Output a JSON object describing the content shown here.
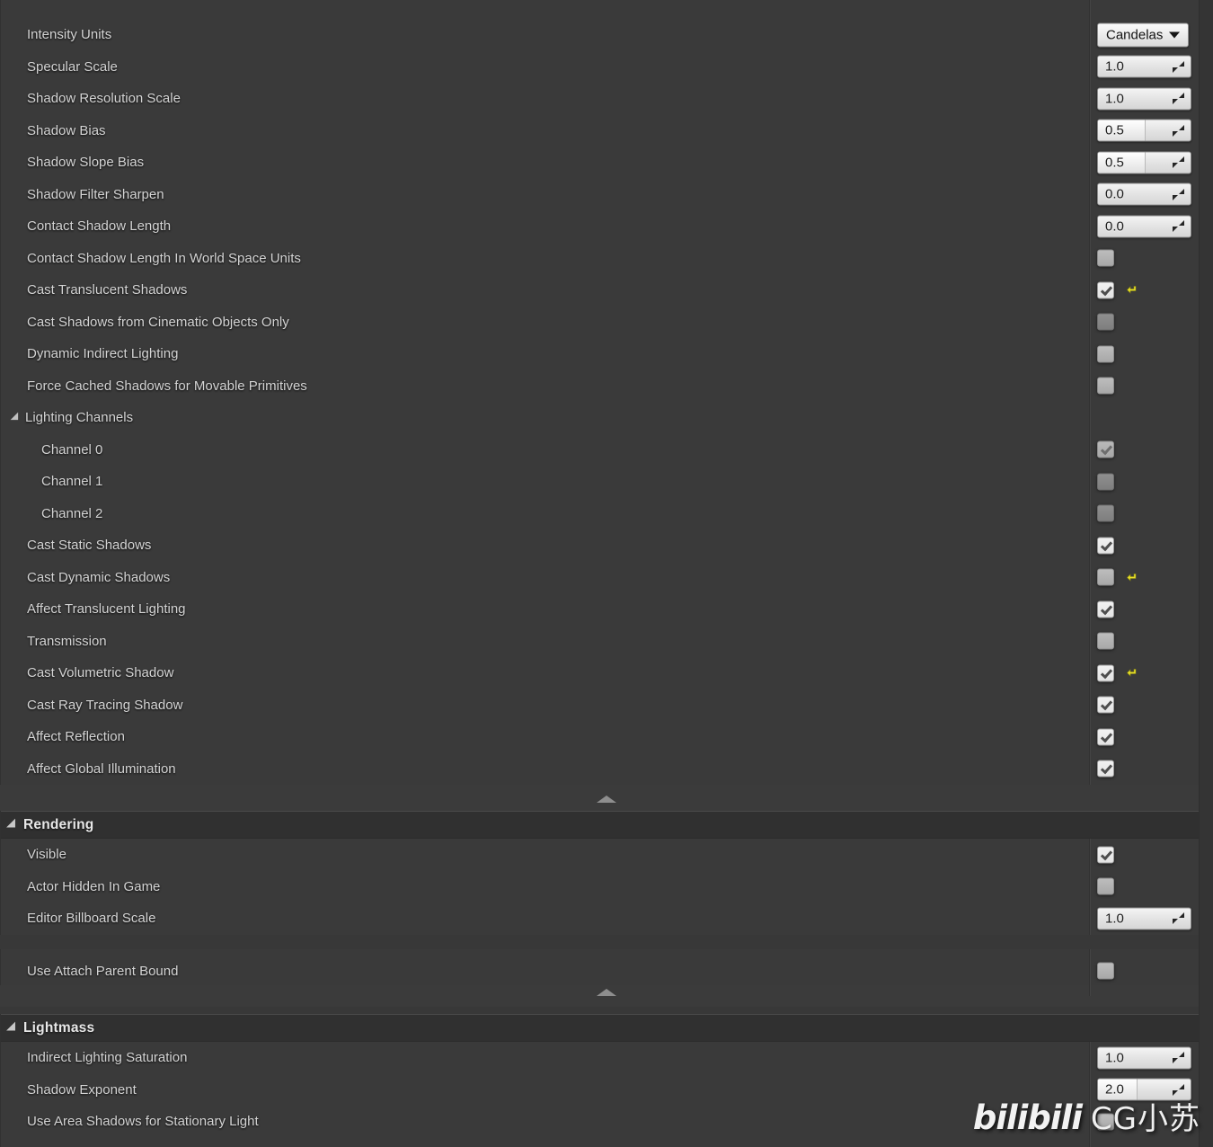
{
  "panel": {
    "light_section": {
      "rows": [
        {
          "label": "Intensity Units",
          "control": "combo",
          "value": "Candelas",
          "indent": 0
        },
        {
          "label": "Specular Scale",
          "control": "spin",
          "value": "1.0",
          "fill": 0,
          "indent": 0
        },
        {
          "label": "Shadow Resolution Scale",
          "control": "spin",
          "value": "1.0",
          "fill": 0,
          "indent": 0
        },
        {
          "label": "Shadow Bias",
          "control": "spin",
          "value": "0.5",
          "fill": 50,
          "indent": 0
        },
        {
          "label": "Shadow Slope Bias",
          "control": "spin",
          "value": "0.5",
          "fill": 50,
          "indent": 0
        },
        {
          "label": "Shadow Filter Sharpen",
          "control": "spin",
          "value": "0.0",
          "fill": 0,
          "indent": 0
        },
        {
          "label": "Contact Shadow Length",
          "control": "spin",
          "value": "0.0",
          "fill": 0,
          "indent": 0
        },
        {
          "label": "Contact Shadow Length In World Space Units",
          "control": "checkbox",
          "checked": false,
          "dim": false,
          "revert": false,
          "indent": 0
        },
        {
          "label": "Cast Translucent Shadows",
          "control": "checkbox",
          "checked": true,
          "dim": false,
          "revert": true,
          "indent": 0
        },
        {
          "label": "Cast Shadows from Cinematic Objects Only",
          "control": "checkbox",
          "checked": false,
          "dim": true,
          "revert": false,
          "indent": 0
        },
        {
          "label": "Dynamic Indirect Lighting",
          "control": "checkbox",
          "checked": false,
          "dim": false,
          "revert": false,
          "indent": 0
        },
        {
          "label": "Force Cached Shadows for Movable Primitives",
          "control": "checkbox",
          "checked": false,
          "dim": false,
          "revert": false,
          "indent": 0
        },
        {
          "label": "Lighting Channels",
          "control": "group",
          "expanded": true,
          "indent": 0
        },
        {
          "label": "Channel 0",
          "control": "checkbox",
          "checked": true,
          "dim": true,
          "revert": false,
          "indent": 1
        },
        {
          "label": "Channel 1",
          "control": "checkbox",
          "checked": false,
          "dim": true,
          "revert": false,
          "indent": 1
        },
        {
          "label": "Channel 2",
          "control": "checkbox",
          "checked": false,
          "dim": true,
          "revert": false,
          "indent": 1
        },
        {
          "label": "Cast Static Shadows",
          "control": "checkbox",
          "checked": true,
          "dim": false,
          "revert": false,
          "indent": 0
        },
        {
          "label": "Cast Dynamic Shadows",
          "control": "checkbox",
          "checked": false,
          "dim": false,
          "revert": true,
          "indent": 0
        },
        {
          "label": "Affect Translucent Lighting",
          "control": "checkbox",
          "checked": true,
          "dim": false,
          "revert": false,
          "indent": 0
        },
        {
          "label": "Transmission",
          "control": "checkbox",
          "checked": false,
          "dim": false,
          "revert": false,
          "indent": 0
        },
        {
          "label": "Cast Volumetric Shadow",
          "control": "checkbox",
          "checked": true,
          "dim": false,
          "revert": true,
          "indent": 0
        },
        {
          "label": "Cast Ray Tracing Shadow",
          "control": "checkbox",
          "checked": true,
          "dim": false,
          "revert": false,
          "indent": 0
        },
        {
          "label": "Affect Reflection",
          "control": "checkbox",
          "checked": true,
          "dim": false,
          "revert": false,
          "indent": 0
        },
        {
          "label": "Affect Global Illumination",
          "control": "checkbox",
          "checked": true,
          "dim": false,
          "revert": false,
          "indent": 0
        }
      ]
    },
    "rendering_section": {
      "title": "Rendering",
      "expanded": true,
      "rows": [
        {
          "label": "Visible",
          "control": "checkbox",
          "checked": true,
          "dim": false,
          "revert": false,
          "indent": 0
        },
        {
          "label": "Actor Hidden In Game",
          "control": "checkbox",
          "checked": false,
          "dim": false,
          "revert": false,
          "indent": 0
        },
        {
          "label": "Editor Billboard Scale",
          "control": "spin",
          "value": "1.0",
          "fill": 0,
          "indent": 0
        }
      ],
      "extra_rows": [
        {
          "label": "Use Attach Parent Bound",
          "control": "checkbox",
          "checked": false,
          "dim": false,
          "revert": false,
          "indent": 0
        }
      ]
    },
    "lightmass_section": {
      "title": "Lightmass",
      "expanded": true,
      "rows": [
        {
          "label": "Indirect Lighting Saturation",
          "control": "spin",
          "value": "1.0",
          "fill": 0,
          "indent": 0
        },
        {
          "label": "Shadow Exponent",
          "control": "spin",
          "value": "2.0",
          "fill": 42,
          "indent": 0
        },
        {
          "label": "Use Area Shadows for Stationary Light",
          "control": "checkbox",
          "checked": false,
          "dim": false,
          "revert": false,
          "indent": 0
        }
      ]
    }
  },
  "watermark": {
    "brand": "bilibili",
    "handle": "CG小苏"
  },
  "colors": {
    "panel_bg": "#3a3a3a",
    "header_bg": "#303030",
    "text": "#d4d4d4",
    "revert_arrow": "#e8e02a",
    "field_bg": "#e9e9e9"
  }
}
